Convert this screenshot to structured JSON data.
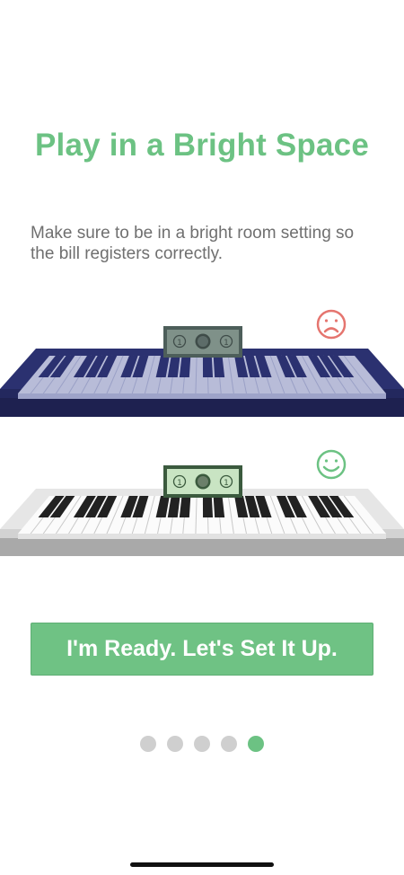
{
  "onboarding": {
    "title": "Play in a Bright Space",
    "description": "Make sure to be in a bright room setting so the bill registers correctly.",
    "cta_label": "I'm Ready. Let's Set It Up.",
    "colors": {
      "accent": "#6cc283",
      "dark_keyboard": "#2b3170",
      "sad_face": "#e5756f",
      "happy_face": "#6cc283"
    },
    "illustrations": [
      {
        "name": "dark-room-keyboard",
        "bill_label": "1",
        "indicator_icon": "sad-face-icon"
      },
      {
        "name": "bright-room-keyboard",
        "bill_label": "1",
        "indicator_icon": "happy-face-icon"
      }
    ],
    "pagination": {
      "total": 5,
      "current": 5
    }
  }
}
